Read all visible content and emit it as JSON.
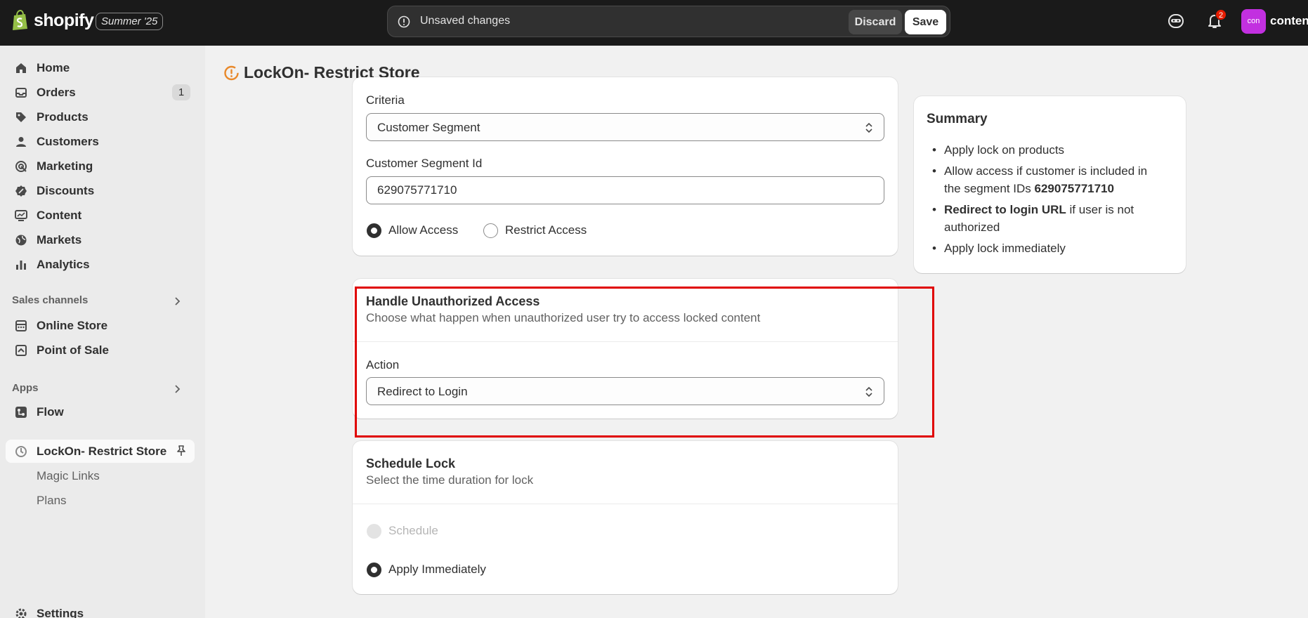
{
  "topbar": {
    "brand": "shopify",
    "edition": "Summer '25",
    "unsaved_text": "Unsaved changes",
    "discard_label": "Discard",
    "save_label": "Save",
    "notification_count": "2",
    "avatar_initials": "con",
    "store_name": "content"
  },
  "sidebar": {
    "items": [
      {
        "label": "Home",
        "icon": "home-icon"
      },
      {
        "label": "Orders",
        "icon": "orders-icon",
        "count": "1"
      },
      {
        "label": "Products",
        "icon": "tag-icon"
      },
      {
        "label": "Customers",
        "icon": "person-icon"
      },
      {
        "label": "Marketing",
        "icon": "target-icon"
      },
      {
        "label": "Discounts",
        "icon": "discount-icon"
      },
      {
        "label": "Content",
        "icon": "content-icon"
      },
      {
        "label": "Markets",
        "icon": "globe-icon"
      },
      {
        "label": "Analytics",
        "icon": "bar-chart-icon"
      }
    ],
    "sales_channels_title": "Sales channels",
    "sales_channels": [
      {
        "label": "Online Store",
        "icon": "store-icon"
      },
      {
        "label": "Point of Sale",
        "icon": "pos-icon"
      }
    ],
    "apps_title": "Apps",
    "apps": [
      {
        "label": "Flow",
        "icon": "flow-icon"
      }
    ],
    "active_app": {
      "label": "LockOn- Restrict Store",
      "icon": "lockon-icon"
    },
    "active_app_subitems": [
      "Magic Links",
      "Plans"
    ],
    "settings_label": "Settings"
  },
  "page": {
    "title": "LockOn- Restrict Store"
  },
  "criteria_card": {
    "criteria_label": "Criteria",
    "criteria_value": "Customer Segment",
    "segment_label": "Customer Segment Id",
    "segment_value": "629075771710",
    "allow_label": "Allow Access",
    "restrict_label": "Restrict Access",
    "selected": "allow"
  },
  "unauthorized_card": {
    "title": "Handle Unauthorized Access",
    "subtitle": "Choose what happen when unauthorized user try to access locked content",
    "action_label": "Action",
    "action_value": "Redirect to Login"
  },
  "schedule_card": {
    "title": "Schedule Lock",
    "subtitle": "Select the time duration for lock",
    "schedule_label": "Schedule",
    "immediately_label": "Apply Immediately",
    "selected": "immediately"
  },
  "summary": {
    "title": "Summary",
    "item1": "Apply lock on products",
    "item2_pre": "Allow access if customer is included in the segment IDs ",
    "item2_bold": "629075771710",
    "item3_bold": "Redirect to login URL",
    "item3_post": " if user is not authorized",
    "item4": "Apply lock immediately"
  },
  "colors": {
    "topbar": "#1a1a1a",
    "highlight": "#e00000",
    "avatar": "#c230e0",
    "notification": "#e51c00"
  }
}
